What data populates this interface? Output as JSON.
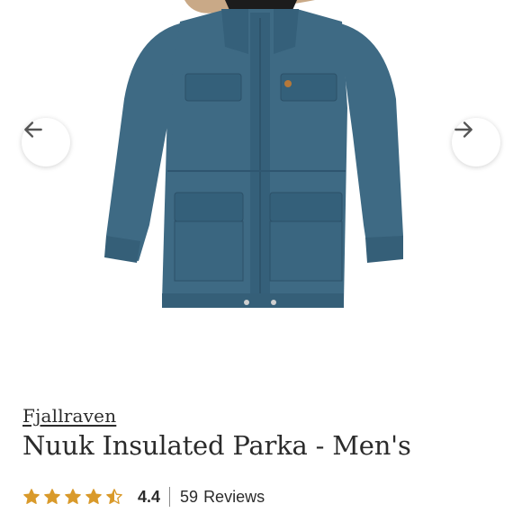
{
  "product": {
    "brand": "Fjallraven",
    "title": "Nuuk Insulated Parka - Men's",
    "image_alt": "parka-image"
  },
  "rating": {
    "value": "4.4",
    "stars": 4.4,
    "max_stars": 5,
    "review_count": "59",
    "review_label": "Reviews",
    "star_color": "#d99a2b"
  },
  "carousel": {
    "prev_icon": "arrow-left-icon",
    "next_icon": "arrow-right-icon"
  },
  "colors": {
    "jacket": "#3e6a84",
    "jacket_dark": "#2f5670",
    "text": "#2b2b2b"
  }
}
